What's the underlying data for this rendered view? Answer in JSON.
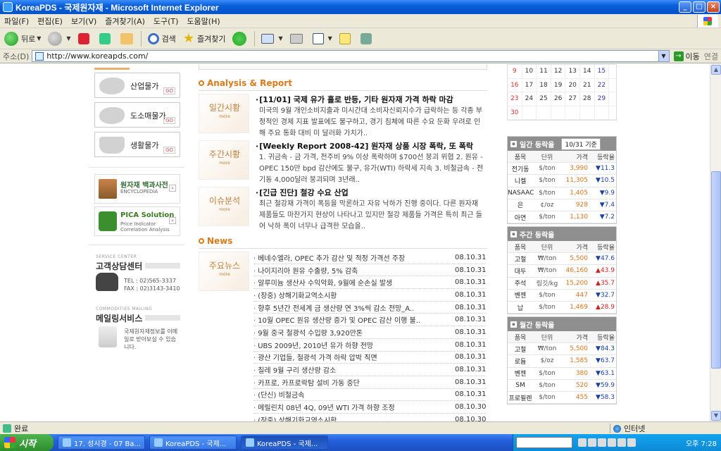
{
  "window": {
    "title": "KoreaPDS - 국제원자재 - Microsoft Internet Explorer",
    "btn_min": "_",
    "btn_max": "□",
    "btn_close": "×"
  },
  "menu": [
    "파일(F)",
    "편집(E)",
    "보기(V)",
    "즐겨찾기(A)",
    "도구(T)",
    "도움말(H)"
  ],
  "toolbar": {
    "back": "뒤로",
    "search": "검색",
    "favorites": "즐겨찾기"
  },
  "address": {
    "label": "주소(D)",
    "url": "http://www.koreapds.com/",
    "go": "이동",
    "links": "연결"
  },
  "left": {
    "price_buttons": [
      "산업물가",
      "도소매물가",
      "생활물가"
    ],
    "go_badge": "GO",
    "promos": [
      {
        "title": "원자재 백과사전",
        "sub": "ENCYCLOPEDIA"
      },
      {
        "title": "PICA Solution",
        "sub": "Price Indicator Correlation Analysis"
      }
    ],
    "service_center": {
      "small": "SERVICE CENTER",
      "title": "고객상담센터",
      "tel": "TEL : 02)565-3337",
      "fax": "FAX : 02)3143-3410"
    },
    "mailing": {
      "small": "COMMODITIES MAILING",
      "title": "메일링서비스",
      "text": "국제원자재정보를 이메일로 받아보실 수 있습니다."
    }
  },
  "analysis": {
    "section_title": "Analysis & Report",
    "more": "more",
    "items": [
      {
        "label": "일간시황",
        "headline": "[11/01] 국제 유가 홀로 반등, 기타 원자재 가격 하락 마감",
        "body": "미국의 9월 개인소비지출과 미시간대 소비자신뢰지수가 급락하는 등 각종 부정적인 경제 지표 발표에도 불구하고, 경기 침체에 따른 수요 둔화 우려로 인해 주요 통화 대비 미 달러화 가치가.."
      },
      {
        "label": "주간시황",
        "headline": "[Weekly Report 2008-42] 원자재 상품 시장 폭락, 또 폭락",
        "body": "1. 귀금속 - 금 가격, 전주비 9% 이상 폭락하며 $700선 붕괴 위협 2. 원유 - OPEC 150만 bpd 감산에도 불구, 유가(WTI) 하락세 지속 3. 비철금속 - 전기동 4,000달러 붕괴되며 3년래.."
      },
      {
        "label": "이슈분석",
        "headline": "[긴급 진단] 철강 수요 산업",
        "body": "최근 철강재 가격이 폭등을 막론하고 자유 낙하가 진행 중이다. 다른 원자재 제품들도 마찬가지 현상이 나타나고 있지만 철강 제품들 가격은 특히 최근 들어 낙하 폭이 너무나 급격한 모습을.."
      }
    ]
  },
  "news": {
    "section_title": "News",
    "label": "주요뉴스",
    "more": "more",
    "items": [
      {
        "title": "베네수엘라, OPEC 추가 감산 및 적정 가격선 주장",
        "date": "08.10.31"
      },
      {
        "title": "나이지리아 원유 수출량, 5% 감축",
        "date": "08.10.31"
      },
      {
        "title": "알루미늄 생산사 수익악화, 9월에 순손실 발생",
        "date": "08.10.31"
      },
      {
        "title": "(장중) 상해기화교역소시황",
        "date": "08.10.31"
      },
      {
        "title": "향후 5년간 전세계 금 생산량 연 3%씩 감소 전망_A..",
        "date": "08.10.31"
      },
      {
        "title": "10월 OPEC 원유 생산량 증가 및 OPEC 감산 이행 불..",
        "date": "08.10.31"
      },
      {
        "title": "9월 중국 철광석 수입량 3,920만톤",
        "date": "08.10.31"
      },
      {
        "title": "UBS 2009년, 2010년 유가 하향 전망",
        "date": "08.10.31"
      },
      {
        "title": "광산 기업들, 철광석 가격 하락 압박 직면",
        "date": "08.10.31"
      },
      {
        "title": "칠레 9월 구리 생산량 감소",
        "date": "08.10.31"
      },
      {
        "title": "카프로, 카프로락탐 설비 가동 중단",
        "date": "08.10.31"
      },
      {
        "title": "(단신) 비철금속",
        "date": "08.10.31"
      },
      {
        "title": "메릴린치 08년 4Q, 09년 WTI 가격 하향 조정",
        "date": "08.10.30"
      },
      {
        "title": "(장중) 상해기화교역소시황",
        "date": "08.10.30"
      }
    ]
  },
  "calendar": {
    "rows": [
      [
        "9",
        "10",
        "11",
        "12",
        "13",
        "14",
        "15"
      ],
      [
        "16",
        "17",
        "18",
        "19",
        "20",
        "21",
        "22"
      ],
      [
        "23",
        "24",
        "25",
        "26",
        "27",
        "28",
        "29"
      ],
      [
        "30",
        "",
        "",
        "",
        "",
        "",
        ""
      ]
    ]
  },
  "tables": {
    "headers": [
      "품목",
      "단위",
      "가격",
      "등락율"
    ],
    "daily": {
      "title": "일간 등락율",
      "as_of": "10/31 기준",
      "rows": [
        {
          "item": "전기동",
          "unit": "$/ton",
          "price": "3,990",
          "change": "▼11.3",
          "dir": "dn"
        },
        {
          "item": "니켈",
          "unit": "$/ton",
          "price": "11,305",
          "change": "▼10.5",
          "dir": "dn"
        },
        {
          "item": "NASAAC",
          "unit": "$/ton",
          "price": "1,405",
          "change": "▼9.9",
          "dir": "dn"
        },
        {
          "item": "은",
          "unit": "¢/oz",
          "price": "928",
          "change": "▼7.4",
          "dir": "dn"
        },
        {
          "item": "아연",
          "unit": "$/ton",
          "price": "1,130",
          "change": "▼7.2",
          "dir": "dn"
        }
      ]
    },
    "weekly": {
      "title": "주간 등락율",
      "rows": [
        {
          "item": "고철",
          "unit": "₩/ton",
          "price": "5,500",
          "change": "▼47.6",
          "dir": "dn"
        },
        {
          "item": "대두",
          "unit": "₩/ton",
          "price": "46,160",
          "change": "▲43.9",
          "dir": "up"
        },
        {
          "item": "주석",
          "unit": "링깃/kg",
          "price": "15,200",
          "change": "▲35.7",
          "dir": "up"
        },
        {
          "item": "벤젠",
          "unit": "$/ton",
          "price": "447",
          "change": "▼32.7",
          "dir": "dn"
        },
        {
          "item": "납",
          "unit": "$/ton",
          "price": "1,469",
          "change": "▲28.9",
          "dir": "up"
        }
      ]
    },
    "monthly": {
      "title": "월간 등락율",
      "rows": [
        {
          "item": "고철",
          "unit": "₩/ton",
          "price": "5,500",
          "change": "▼84.3",
          "dir": "dn"
        },
        {
          "item": "로듐",
          "unit": "$/oz",
          "price": "1,585",
          "change": "▼63.7",
          "dir": "dn"
        },
        {
          "item": "벤젠",
          "unit": "$/ton",
          "price": "380",
          "change": "▼63.1",
          "dir": "dn"
        },
        {
          "item": "SM",
          "unit": "$/ton",
          "price": "520",
          "change": "▼59.9",
          "dir": "dn"
        },
        {
          "item": "프로필렌",
          "unit": "$/ton",
          "price": "455",
          "change": "▼58.3",
          "dir": "dn"
        }
      ]
    }
  },
  "status": {
    "text": "완료",
    "zone": "인터넷"
  },
  "taskbar": {
    "start": "시작",
    "tasks": [
      "17. 성시경 - 07 Ba...",
      "KoreaPDS - 국제...",
      "KoreaPDS - 국제..."
    ],
    "clock": "오후 7:28"
  }
}
